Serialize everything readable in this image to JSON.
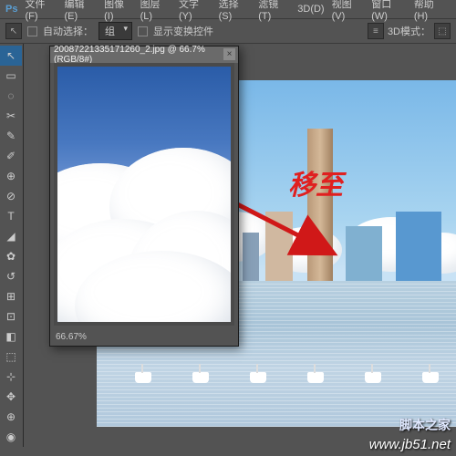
{
  "menu": {
    "file": "文件(F)",
    "edit": "编辑(E)",
    "image": "图像(I)",
    "layer": "图层(L)",
    "text": "文字(Y)",
    "select": "选择(S)",
    "filter": "滤镜(T)",
    "d3": "3D(D)",
    "view": "视图(V)",
    "window": "窗口(W)",
    "help": "帮助(H)"
  },
  "options": {
    "auto_select": "自动选择：",
    "auto_select_value": "组",
    "show_transform": "显示变换控件",
    "d3_mode": "3D模式："
  },
  "float_window": {
    "title": "20087221335171260_2.jpg @ 66.7%(RGB/8#)",
    "zoom": "66.67%"
  },
  "annotation": {
    "text": "移至"
  },
  "watermark": {
    "site": "脚本之家",
    "url": "www.jb51.net"
  },
  "tools": [
    "↖",
    "▭",
    "◌",
    "✂",
    "✎",
    "✐",
    "⊕",
    "⊘",
    "T",
    "◢",
    "✿",
    "↺",
    "⊞",
    "⊡",
    "◧",
    "⬚",
    "⊹",
    "✥",
    "⊕",
    "◉"
  ]
}
